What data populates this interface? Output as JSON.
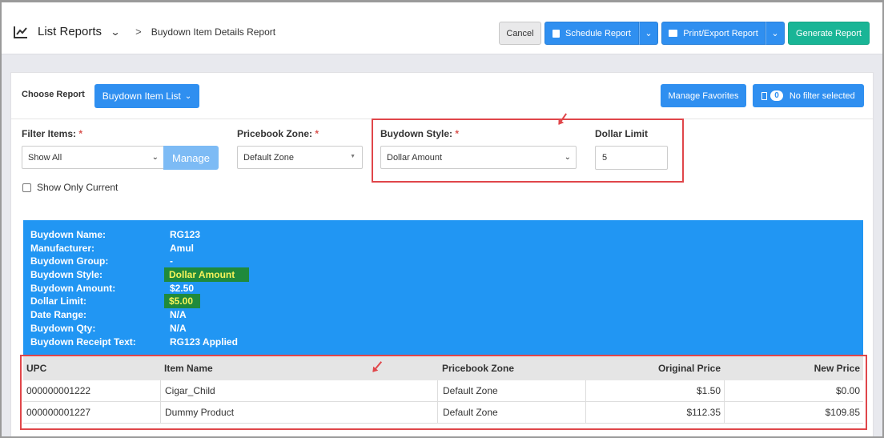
{
  "header": {
    "nav_title": "List Reports",
    "breadcrumb": "Buydown Item Details Report",
    "cancel_label": "Cancel",
    "schedule_label": "Schedule Report",
    "print_label": "Print/Export Report",
    "generate_label": "Generate Report"
  },
  "controls": {
    "choose_label": "Choose Report",
    "choose_value": "Buydown Item List",
    "manage_favorites_label": "Manage Favorites",
    "filter_badge": "0",
    "filter_label": "No filter selected"
  },
  "filters": {
    "filter_items_label": "Filter Items:",
    "filter_items_value": "Show All",
    "manage_label": "Manage",
    "pricebook_zone_label": "Pricebook Zone:",
    "pricebook_zone_value": "Default Zone",
    "buydown_style_label": "Buydown Style:",
    "buydown_style_value": "Dollar Amount",
    "dollar_limit_label": "Dollar Limit",
    "dollar_limit_value": "5",
    "show_only_current_label": "Show Only Current",
    "required_mark": "*"
  },
  "info": {
    "rows": [
      {
        "label": "Buydown Name:",
        "value": "RG123"
      },
      {
        "label": "Manufacturer:",
        "value": "Amul"
      },
      {
        "label": "Buydown Group:",
        "value": "-"
      },
      {
        "label": "Buydown Style:",
        "value": "Dollar Amount"
      },
      {
        "label": "Buydown Amount:",
        "value": "$2.50"
      },
      {
        "label": "Dollar Limit:",
        "value": "$5.00"
      },
      {
        "label": "Date Range:",
        "value": "N/A"
      },
      {
        "label": "Buydown Qty:",
        "value": "N/A"
      },
      {
        "label": "Buydown Receipt Text:",
        "value": "RG123 Applied"
      }
    ]
  },
  "table": {
    "columns": [
      "UPC",
      "Item Name",
      "Pricebook Zone",
      "Original Price",
      "New Price"
    ],
    "rows": [
      [
        "000000001222",
        "Cigar_Child",
        "Default Zone",
        "$1.50",
        "$0.00"
      ],
      [
        "000000001227",
        "Dummy Product",
        "Default Zone",
        "$112.35",
        "$109.85"
      ]
    ]
  },
  "colors": {
    "primary": "#2f8ff0",
    "success": "#19b596",
    "info_bg": "#2196f3",
    "highlight_bg": "#1f8a3c",
    "highlight_text": "#f6f35a",
    "annotation": "#e0464a"
  },
  "icons": {
    "nav": "line-chart-icon",
    "schedule": "calendar-icon",
    "print": "printer-icon",
    "filter": "filter-icon"
  }
}
